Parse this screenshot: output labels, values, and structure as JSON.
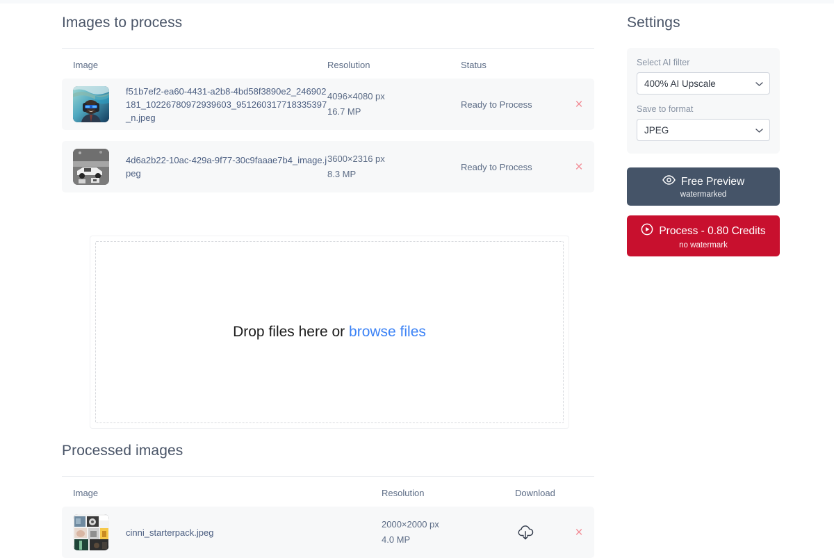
{
  "sections": {
    "images_to_process": {
      "title": "Images to process",
      "columns": {
        "image": "Image",
        "resolution": "Resolution",
        "status": "Status"
      },
      "rows": [
        {
          "filename": "f51b7ef2-ea60-4431-a2b8-4bd58f3890e2_246902181_10226780972939603_951260317718335397_n.jpeg",
          "resolution": "4096×4080 px",
          "megapixels": "16.7 MP",
          "status": "Ready to Process",
          "remove_label": "×"
        },
        {
          "filename": "4d6a2b22-10ac-429a-9f77-30c9faaae7b4_image.jpeg",
          "resolution": "3600×2316 px",
          "megapixels": "8.3 MP",
          "status": "Ready to Process",
          "remove_label": "×"
        }
      ]
    },
    "dropzone": {
      "text": "Drop files here or",
      "link": "browse files"
    },
    "processed_images": {
      "title": "Processed images",
      "columns": {
        "image": "Image",
        "resolution": "Resolution",
        "download": "Download"
      },
      "rows": [
        {
          "filename": "cinni_starterpack.jpeg",
          "resolution": "2000×2000 px",
          "megapixels": "4.0 MP",
          "download_icon": "cloud-download-icon",
          "remove_label": "×"
        }
      ]
    }
  },
  "settings": {
    "title": "Settings",
    "ai_filter": {
      "label": "Select AI filter",
      "value": "400% AI Upscale"
    },
    "save_format": {
      "label": "Save to format",
      "value": "JPEG"
    },
    "preview_button": {
      "label": "Free Preview",
      "sublabel": "watermarked",
      "icon": "eye-icon"
    },
    "process_button": {
      "label": "Process - 0.80 Credits",
      "sublabel": "no watermark",
      "icon": "play-circle-icon"
    }
  },
  "colors": {
    "preview_bg": "#455468",
    "process_bg": "#c8102e",
    "link": "#3b82f6",
    "remove": "#f28b95",
    "row_bg": "#f7f8f9",
    "heading": "#4a5568"
  }
}
